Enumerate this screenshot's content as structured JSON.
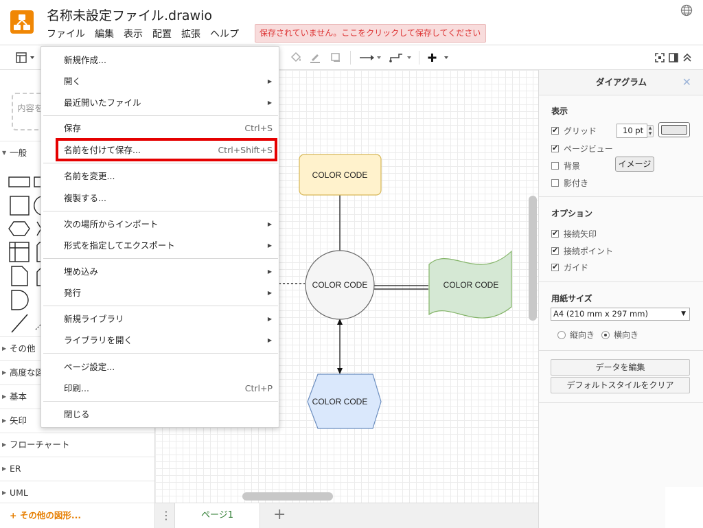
{
  "app": {
    "title": "名称未設定ファイル.drawio",
    "unsaved_notice": "保存されていません。ここをクリックして保存してください",
    "brand_color": "#f08705"
  },
  "menubar": [
    "ファイル",
    "編集",
    "表示",
    "配置",
    "拡張",
    "ヘルプ"
  ],
  "file_menu": {
    "items": [
      {
        "label": "新規作成...",
        "shortcut": "",
        "submenu": false
      },
      {
        "label": "開く",
        "shortcut": "",
        "submenu": true
      },
      {
        "label": "最近開いたファイル",
        "shortcut": "",
        "submenu": true
      },
      {
        "label": "保存",
        "shortcut": "Ctrl+S",
        "submenu": false
      },
      {
        "label": "名前を付けて保存...",
        "shortcut": "Ctrl+Shift+S",
        "submenu": false,
        "highlighted": true
      },
      {
        "label": "名前を変更...",
        "shortcut": "",
        "submenu": false
      },
      {
        "label": "複製する...",
        "shortcut": "",
        "submenu": false
      },
      {
        "label": "次の場所からインポート",
        "shortcut": "",
        "submenu": true
      },
      {
        "label": "形式を指定してエクスポート",
        "shortcut": "",
        "submenu": true
      },
      {
        "label": "埋め込み",
        "shortcut": "",
        "submenu": true
      },
      {
        "label": "発行",
        "shortcut": "",
        "submenu": true
      },
      {
        "label": "新規ライブラリ",
        "shortcut": "",
        "submenu": true
      },
      {
        "label": "ライブラリを開く",
        "shortcut": "",
        "submenu": true
      },
      {
        "label": "ページ設定...",
        "shortcut": "",
        "submenu": false
      },
      {
        "label": "印刷...",
        "shortcut": "Ctrl+P",
        "submenu": false
      },
      {
        "label": "閉じる",
        "shortcut": "",
        "submenu": false
      }
    ],
    "highlight_color": "#e50000"
  },
  "sidebar": {
    "scratchpad_hint": "内容を",
    "general_label": "一般",
    "sections": [
      "その他",
      "高度な図",
      "基本",
      "矢印",
      "フローチャート",
      "ER",
      "UML"
    ],
    "more_shapes": "+ その他の図形...",
    "more_shapes_color": "#e67e00"
  },
  "diagram": {
    "shapes": [
      {
        "label": "COLOR CODE",
        "kind": "rounded-rect",
        "fill": "#fff2cc",
        "stroke": "#d6b656"
      },
      {
        "label": "COLOR CODE",
        "kind": "ellipse",
        "fill": "#f5f5f5",
        "stroke": "#666666"
      },
      {
        "label": "COLOR CODE",
        "kind": "tape",
        "fill": "#d5e8d4",
        "stroke": "#82b366"
      },
      {
        "label": "COLOR CODE",
        "kind": "hexagon",
        "fill": "#dae8fc",
        "stroke": "#6c8ebf"
      }
    ]
  },
  "pages": {
    "current": "ページ1",
    "add_label": "+"
  },
  "format_panel": {
    "title": "ダイアグラム",
    "close_label": "✕",
    "view_section": "表示",
    "grid_label": "グリッド",
    "grid_checked": true,
    "grid_size": "10 pt",
    "page_view_label": "ページビュー",
    "page_view_checked": true,
    "background_label": "背景",
    "background_checked": false,
    "image_button": "イメージ",
    "shadow_label": "影付き",
    "shadow_checked": false,
    "options_section": "オプション",
    "connection_arrows_label": "接続矢印",
    "connection_points_label": "接続ポイント",
    "guides_label": "ガイド",
    "paper_section": "用紙サイズ",
    "paper_size": "A4 (210 mm x 297 mm)",
    "portrait_label": "縦向き",
    "landscape_label": "横向き",
    "orientation": "landscape",
    "edit_data_button": "データを編集",
    "clear_style_button": "デフォルトスタイルをクリア"
  }
}
